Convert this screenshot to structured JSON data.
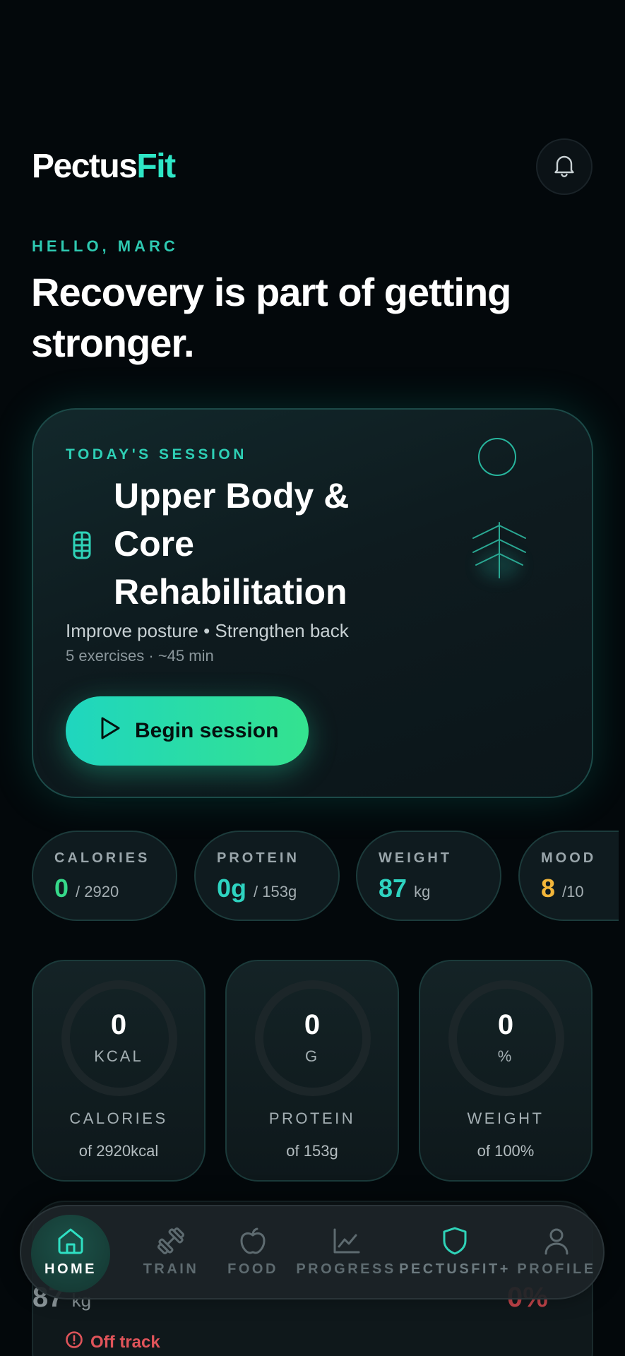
{
  "app": {
    "logo_main": "Pectus",
    "logo_accent": "Fit"
  },
  "header": {
    "bell_icon": "bell-icon"
  },
  "greeting": "HELLO, MARC",
  "headline_line1": "Recovery is part of getting",
  "headline_line2": "stronger.",
  "session": {
    "label": "TODAY'S SESSION",
    "title_line1": "Upper Body &",
    "title_line2": "Core",
    "title_line3": "Rehabilitation",
    "description": "Improve posture • Strengthen back",
    "meta": "5 exercises · ~45 min",
    "button_label": "Begin session"
  },
  "stats": [
    {
      "label": "CALORIES",
      "value": "0",
      "unit": "/ 2920",
      "color": "#36d98a"
    },
    {
      "label": "PROTEIN",
      "value": "0g",
      "unit": "/ 153g",
      "color": "#2ed3c0"
    },
    {
      "label": "WEIGHT",
      "value": "87",
      "unit": "kg",
      "color": "#2ed3c0"
    },
    {
      "label": "MOOD",
      "value": "8",
      "unit": "/10",
      "color": "#f2b63a"
    }
  ],
  "rings": [
    {
      "value": "0",
      "unit": "KCAL",
      "label": "CALORIES",
      "sub": "of 2920kcal",
      "progress": 0
    },
    {
      "value": "0",
      "unit": "G",
      "label": "PROTEIN",
      "sub": "of 153g",
      "progress": 0
    },
    {
      "value": "0",
      "unit": "%",
      "label": "WEIGHT",
      "sub": "of 100%",
      "progress": 0
    }
  ],
  "hidden_card": {
    "value": "87",
    "unit": "kg",
    "percent": "0%",
    "status": "Off track"
  },
  "nav": [
    {
      "label": "HOME",
      "icon": "home-icon",
      "active": true
    },
    {
      "label": "TRAIN",
      "icon": "dumbbell-icon",
      "active": false
    },
    {
      "label": "FOOD",
      "icon": "apple-icon",
      "active": false
    },
    {
      "label": "PROGRESS",
      "icon": "chart-line-icon",
      "active": false
    },
    {
      "label": "PECTUSFIT+",
      "icon": "shield-icon",
      "active": false
    },
    {
      "label": "PROFILE",
      "icon": "user-icon",
      "active": false
    }
  ]
}
